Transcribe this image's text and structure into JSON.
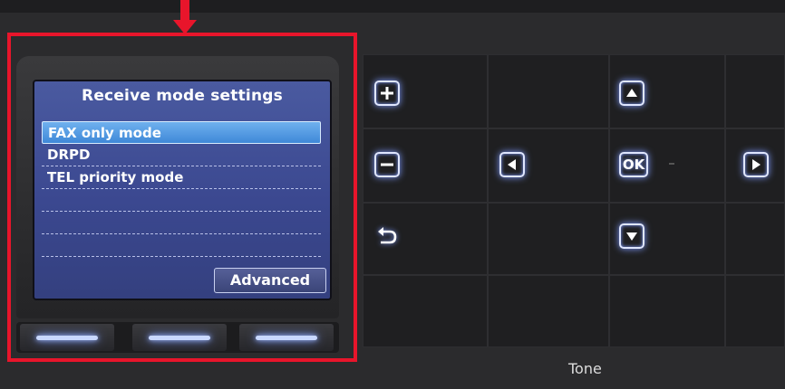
{
  "screen": {
    "title": "Receive mode settings",
    "items": [
      {
        "label": "FAX only mode",
        "selected": true
      },
      {
        "label": "DRPD",
        "selected": false
      },
      {
        "label": "TEL priority mode",
        "selected": false
      },
      {
        "label": "",
        "selected": false
      },
      {
        "label": "",
        "selected": false
      },
      {
        "label": "",
        "selected": false
      }
    ],
    "advanced_label": "Advanced"
  },
  "panel": {
    "ok_label": "OK",
    "tone_label": "Tone"
  },
  "colors": {
    "highlight": "#e8152b",
    "lcd_background": "#3b4890",
    "selection": "#3f88d8",
    "key_glow": "#dfe6ff"
  },
  "icons": {
    "plus": "plus-icon",
    "minus": "minus-icon",
    "back": "back-icon",
    "up": "arrow-up-icon",
    "down": "arrow-down-icon",
    "left": "arrow-left-icon",
    "right": "arrow-right-icon",
    "pointer": "red-arrow-down-icon"
  }
}
